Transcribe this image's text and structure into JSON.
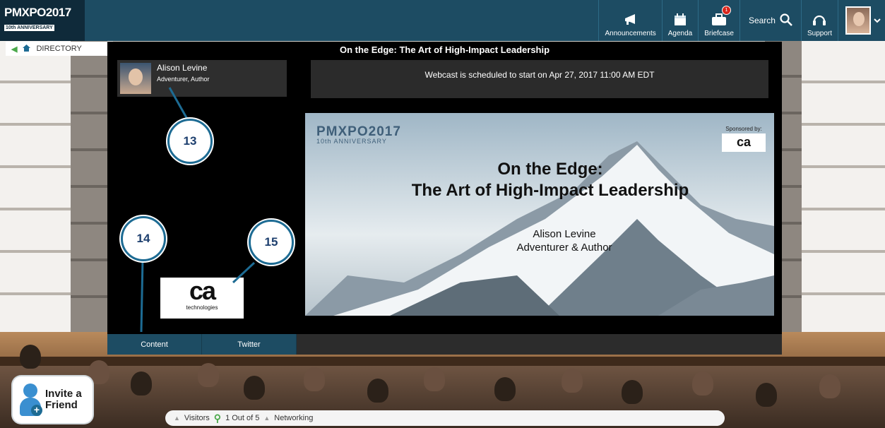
{
  "header": {
    "logo_main": "PMXPO2017",
    "logo_sub": "10th ANNIVERSARY",
    "nav": [
      {
        "label": "Announcements",
        "icon": "megaphone-icon"
      },
      {
        "label": "Agenda",
        "icon": "calendar-icon"
      },
      {
        "label": "Briefcase",
        "icon": "briefcase-icon",
        "badge": "1"
      }
    ],
    "search_label": "Search",
    "support_label": "Support"
  },
  "directory": {
    "label": "DIRECTORY"
  },
  "session": {
    "title": "On the Edge: The Art of High-Impact Leadership",
    "speaker_name": "Alison Levine",
    "speaker_role": "Adventurer, Author",
    "notice": "Webcast is scheduled to start on  Apr 27, 2017 11:00 AM EDT"
  },
  "slide": {
    "logo_main": "PMXPO2017",
    "logo_sub": "10th ANNIVERSARY",
    "sponsored_by": "Sponsored by:",
    "sponsor_logo": "ca",
    "title_line1": "On the Edge:",
    "title_line2": "The Art of High-Impact Leadership",
    "speaker_line1": "Alison Levine",
    "speaker_line2": "Adventurer & Author"
  },
  "sponsor": {
    "logo_big": "ca",
    "logo_small": "technologies"
  },
  "tabs": [
    {
      "label": "Content"
    },
    {
      "label": "Twitter"
    }
  ],
  "callouts": [
    "13",
    "14",
    "15"
  ],
  "invite": {
    "line1": "Invite a",
    "line2": "Friend"
  },
  "bottombar": {
    "visitors": "Visitors",
    "count": "1 Out of 5",
    "networking": "Networking"
  },
  "colors": {
    "primary": "#1d4c63",
    "accent": "#1d6b93",
    "badge": "#d9261c"
  }
}
